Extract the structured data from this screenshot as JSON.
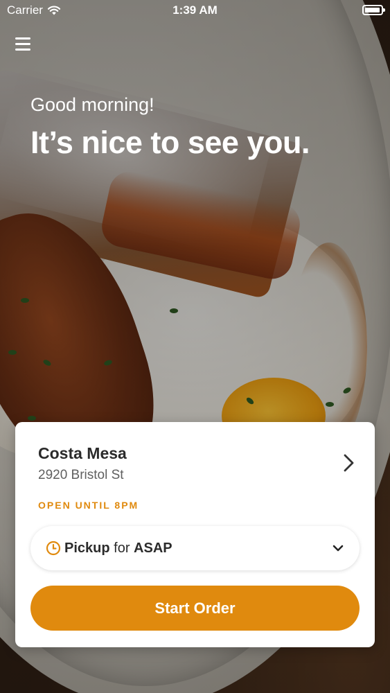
{
  "status_bar": {
    "carrier": "Carrier",
    "time": "1:39 AM"
  },
  "hero": {
    "greeting": "Good morning!",
    "headline": "It’s nice to see you."
  },
  "location": {
    "name": "Costa Mesa",
    "address": "2920 Bristol St",
    "hours": "OPEN UNTIL 8PM"
  },
  "order_mode": {
    "mode": "Pickup",
    "connector": "for",
    "time": "ASAP"
  },
  "start_order_label": "Start Order",
  "colors": {
    "accent": "#e08a0e",
    "card": "#ffffff"
  }
}
